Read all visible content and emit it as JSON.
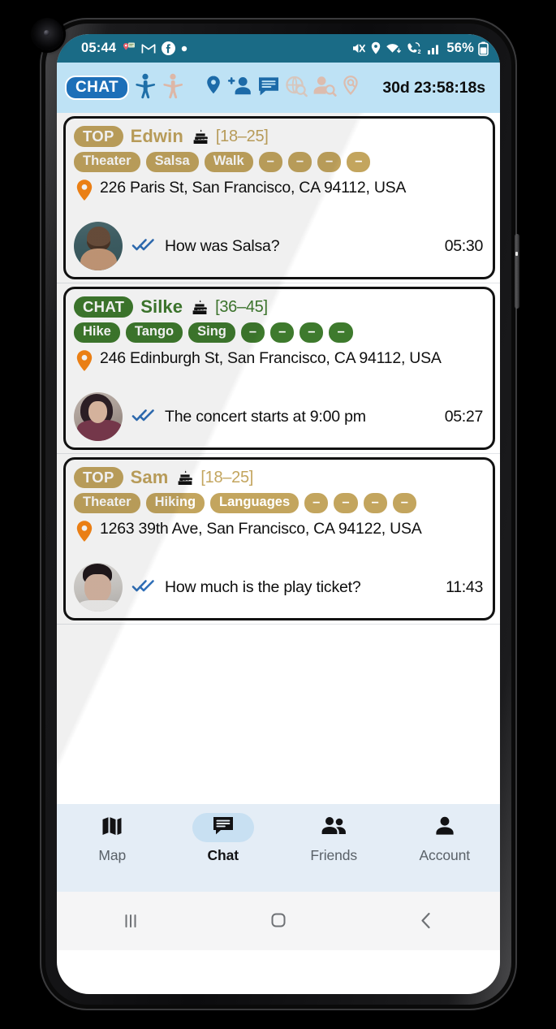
{
  "status_bar": {
    "time": "05:44",
    "left_icons": [
      "location-message-icon",
      "gmail-icon",
      "facebook-icon",
      "dot-icon"
    ],
    "right_icons": [
      "mute-icon",
      "location-icon",
      "wifi-icon",
      "call-sim-icon",
      "signal-icon"
    ],
    "battery_percent": "56%"
  },
  "app_bar": {
    "mode_pill": "CHAT",
    "icons": [
      {
        "name": "gender-male-icon",
        "state": "active"
      },
      {
        "name": "gender-female-icon",
        "state": "inactive"
      },
      {
        "name": "location-pin-icon",
        "state": "active"
      },
      {
        "name": "add-person-icon",
        "state": "active"
      },
      {
        "name": "chat-bubble-icon",
        "state": "active"
      },
      {
        "name": "globe-search-icon",
        "state": "disabled"
      },
      {
        "name": "person-search-icon",
        "state": "disabled"
      },
      {
        "name": "pin-search-icon",
        "state": "disabled"
      }
    ],
    "timer": "30d 23:58:18s"
  },
  "colors": {
    "gold": "#c3a55e",
    "green": "#3e7a2d",
    "accent_blue": "#1d6fb8",
    "app_bar_bg": "#bee2f5",
    "status_bar_bg": "#1a6b86",
    "pin_orange": "#f98716",
    "check_blue": "#2f6fb8"
  },
  "cards": [
    {
      "badge": "TOP",
      "badge_style": "gold",
      "name": "Edwin",
      "age": "[18–25]",
      "tags": [
        "Theater",
        "Salsa",
        "Walk"
      ],
      "empty_tags": [
        "–",
        "–",
        "–",
        "–"
      ],
      "address": "226 Paris St, San Francisco, CA 94112, USA",
      "message": "How was Salsa?",
      "time": "05:30",
      "avatar": "avatar-edwin"
    },
    {
      "badge": "CHAT",
      "badge_style": "green",
      "name": "Silke",
      "age": "[36–45]",
      "tags": [
        "Hike",
        "Tango",
        "Sing"
      ],
      "empty_tags": [
        "–",
        "–",
        "–",
        "–"
      ],
      "address": "246 Edinburgh St, San Francisco, CA 94112, USA",
      "message": "The concert starts at 9:00 pm",
      "time": "05:27",
      "avatar": "avatar-silke"
    },
    {
      "badge": "TOP",
      "badge_style": "gold",
      "name": "Sam",
      "age": "[18–25]",
      "tags": [
        "Theater",
        "Hiking",
        "Languages"
      ],
      "empty_tags": [
        "–",
        "–",
        "–",
        "–"
      ],
      "address": "1263 39th Ave, San Francisco, CA 94122, USA",
      "message": "How much is the play ticket?",
      "time": "11:43",
      "avatar": "avatar-sam"
    }
  ],
  "bottom_nav": {
    "items": [
      {
        "label": "Map",
        "icon": "map-icon",
        "active": false
      },
      {
        "label": "Chat",
        "icon": "chat-icon",
        "active": true
      },
      {
        "label": "Friends",
        "icon": "friends-icon",
        "active": false
      },
      {
        "label": "Account",
        "icon": "account-icon",
        "active": false
      }
    ]
  },
  "system_nav": {
    "recents": "recents-icon",
    "home": "home-icon",
    "back": "back-icon"
  }
}
